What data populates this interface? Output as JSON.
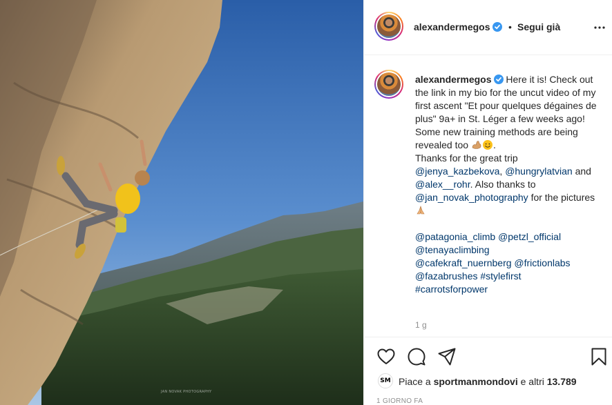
{
  "photo": {
    "alt_subject": "climber",
    "watermark": "JAN NOVAK PHOTOGRAPHY"
  },
  "header": {
    "username": "alexandermegos",
    "separator": "•",
    "follow_label": "Segui già",
    "more_icon": "more-horizontal-icon"
  },
  "caption": {
    "username": "alexandermegos",
    "line1": "Here it is! Check out the link in my bio for the uncut video of my first ascent \"Et pour quelques dégaines de plus\" 9a+ in St. Léger a few weeks ago! Some new training methods are being revealed too",
    "line1_end": ".",
    "thanks_start": "Thanks for the great trip",
    "mention1": "@jenya_kazbekova",
    "comma": ",",
    "mention2": "@hungrylatvian",
    "and": "and",
    "mention3": "@alex__rohr",
    "also": ". Also thanks to",
    "mention4": "@jan_novak_photography",
    "for_the": "for the pictures",
    "tags": [
      "@patagonia_climb",
      "@petzl_official",
      "@tenayaclimbing",
      "@cafekraft_nuernberg",
      "@frictionlabs",
      "@fazabrushes",
      "#stylefirst",
      "#carrotsforpower"
    ],
    "emojis": [
      "flexed-biceps-icon",
      "smiling-face-icon",
      "folded-hands-icon"
    ]
  },
  "time_ago": "1 g",
  "actions": {
    "like_icon": "heart-icon",
    "comment_icon": "comment-icon",
    "share_icon": "paper-plane-icon",
    "save_icon": "bookmark-icon"
  },
  "likes": {
    "prefix": "Piace a",
    "user": "sportmanmondovi",
    "suffix": "e altri",
    "count": "13.789"
  },
  "date": "1 GIORNO FA",
  "colors": {
    "link": "#00376b",
    "verified": "#3897f0",
    "muted": "#8e8e8e"
  }
}
